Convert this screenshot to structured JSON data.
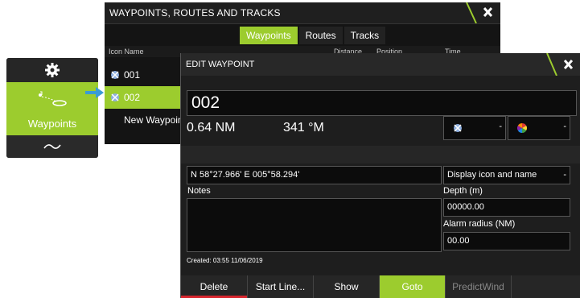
{
  "side_menu": {
    "item_label": "Waypoints"
  },
  "back_dialog": {
    "title": "WAYPOINTS, ROUTES AND TRACKS",
    "tabs": [
      "Waypoints",
      "Routes",
      "Tracks"
    ],
    "columns": {
      "icon_name": "Icon Name",
      "distance": "Distance",
      "position": "Position",
      "time": "Time"
    },
    "rows": [
      {
        "name": "001",
        "selected": false
      },
      {
        "name": "002",
        "selected": true
      },
      {
        "name": "New Waypoint..."
      }
    ]
  },
  "edit_waypoint": {
    "title": "EDIT WAYPOINT",
    "name_value": "002",
    "distance": "0.64 NM",
    "bearing": "341 °M",
    "position": "N 58°27.966'  E 005°58.294'",
    "display_option": "Display icon and name",
    "notes_label": "Notes",
    "depth_label": "Depth (m)",
    "depth_value": "00000.00",
    "alarm_label": "Alarm radius (NM)",
    "alarm_value": "00.00",
    "created": "Created: 03:55  11/06/2019",
    "dropdown_arrow": "-",
    "buttons": {
      "delete": "Delete",
      "start_line": "Start Line...",
      "show": "Show",
      "goto": "Goto",
      "predictwind": "PredictWind"
    }
  },
  "colors": {
    "accent": "#9ccc2e",
    "panel": "#1e1e1e",
    "danger": "#d7262e"
  }
}
